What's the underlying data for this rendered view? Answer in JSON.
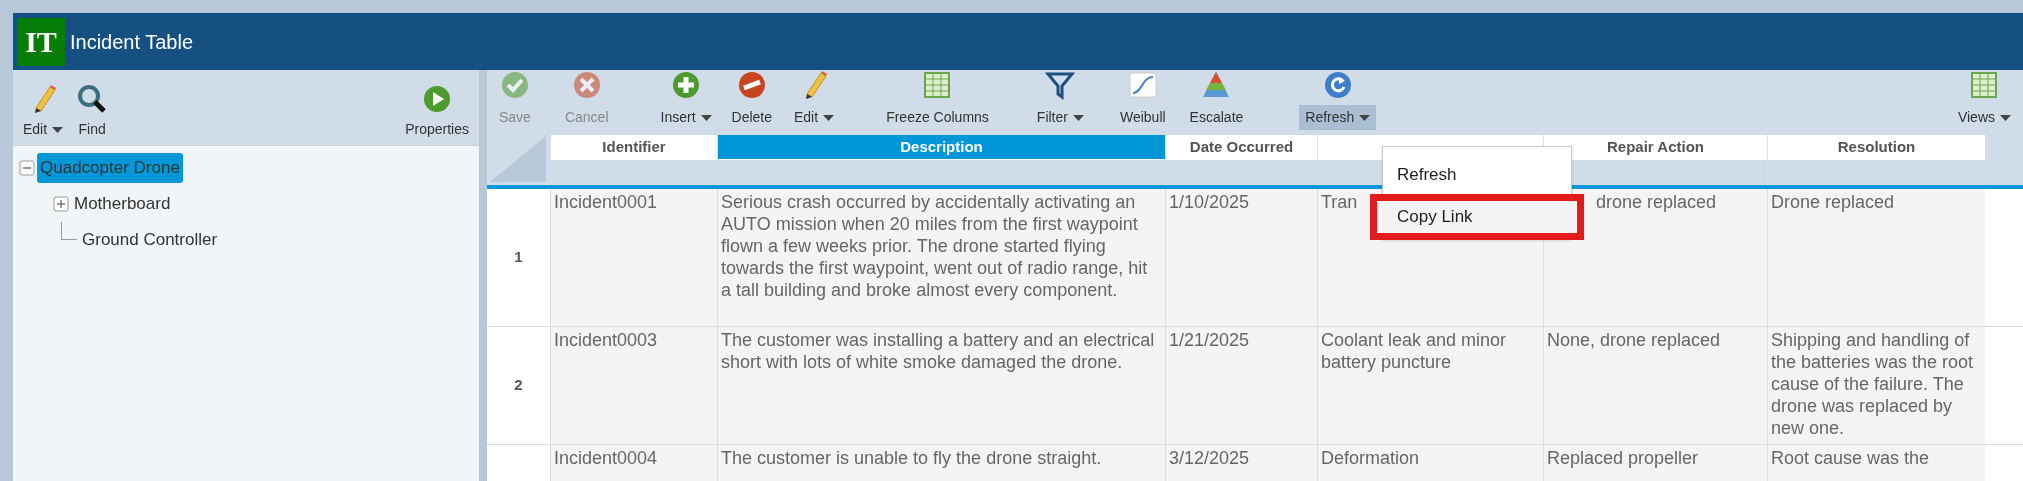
{
  "title_bar": {
    "logo": "IT",
    "title": "Incident Table"
  },
  "left_toolbar": [
    {
      "kind": "pencil",
      "label": "Edit",
      "has_menu": true
    },
    {
      "kind": "magnifier",
      "label": "Find",
      "has_menu": false
    },
    {
      "kind": "play",
      "label": "Properties",
      "has_menu": false
    }
  ],
  "tree": [
    {
      "label": "Quadcopter Drone",
      "selected": true,
      "expanded": true,
      "children": [
        {
          "label": "Motherboard",
          "selected": false,
          "expanded": false
        },
        {
          "label": "Ground Controller",
          "selected": false
        }
      ]
    }
  ],
  "toolbar": [
    {
      "kind": "check",
      "label": "Save",
      "disabled": true,
      "has_menu": false,
      "active": false
    },
    {
      "kind": "cross",
      "label": "Cancel",
      "disabled": true,
      "has_menu": false,
      "active": false
    },
    {
      "kind": "plus",
      "label": "Insert",
      "disabled": false,
      "has_menu": true,
      "active": false
    },
    {
      "kind": "minus",
      "label": "Delete",
      "disabled": false,
      "has_menu": false,
      "active": false
    },
    {
      "kind": "pencil",
      "label": "Edit",
      "disabled": false,
      "has_menu": true,
      "active": false
    },
    {
      "kind": "grid",
      "label": "Freeze Columns",
      "disabled": false,
      "has_menu": false,
      "active": false
    },
    {
      "kind": "funnel",
      "label": "Filter",
      "disabled": false,
      "has_menu": true,
      "active": false
    },
    {
      "kind": "curve",
      "label": "Weibull",
      "disabled": false,
      "has_menu": false,
      "active": false
    },
    {
      "kind": "pyramid",
      "label": "Escalate",
      "disabled": false,
      "has_menu": false,
      "active": false
    },
    {
      "kind": "refresh",
      "label": "Refresh",
      "disabled": false,
      "has_menu": true,
      "active": true
    },
    {
      "kind": "grid",
      "label": "Views",
      "disabled": false,
      "has_menu": true,
      "active": false
    }
  ],
  "refresh_menu": {
    "items": [
      {
        "label": "Refresh",
        "highlighted": false
      },
      {
        "label": "Copy Link",
        "highlighted": true
      }
    ]
  },
  "table": {
    "columns": [
      {
        "label": "Identifier",
        "selected": false
      },
      {
        "label": "Description",
        "selected": true
      },
      {
        "label": "Date Occurred",
        "selected": false
      },
      {
        "selected": false
      },
      {
        "label": "Repair Action",
        "selected": false
      },
      {
        "label": "Resolution",
        "selected": false
      }
    ],
    "rows": [
      {
        "number": "1",
        "cells": [
          "Incident0001",
          "Serious crash occurred by accidentally activating an AUTO mission when 20 miles from the first waypoint flown a few weeks prior. The drone started flying towards the first waypoint, went out of radio range, hit a tall building and broke almost every component.",
          "1/10/2025",
          "Tran",
          "drone replaced",
          "Drone replaced"
        ]
      },
      {
        "number": "2",
        "cells": [
          "Incident0003",
          "The customer was installing a battery and an electrical short with lots of white smoke damaged the drone.",
          "1/21/2025",
          "Coolant leak and minor battery puncture",
          "None, drone replaced",
          "Shipping and handling of the batteries was the root cause of the failure. The drone was replaced by new one."
        ]
      },
      {
        "cells": [
          "Incident0004",
          "The customer is unable to fly the drone straight.",
          "3/12/2025",
          "Deformation",
          "Replaced propeller",
          "Root cause was the"
        ]
      }
    ]
  }
}
